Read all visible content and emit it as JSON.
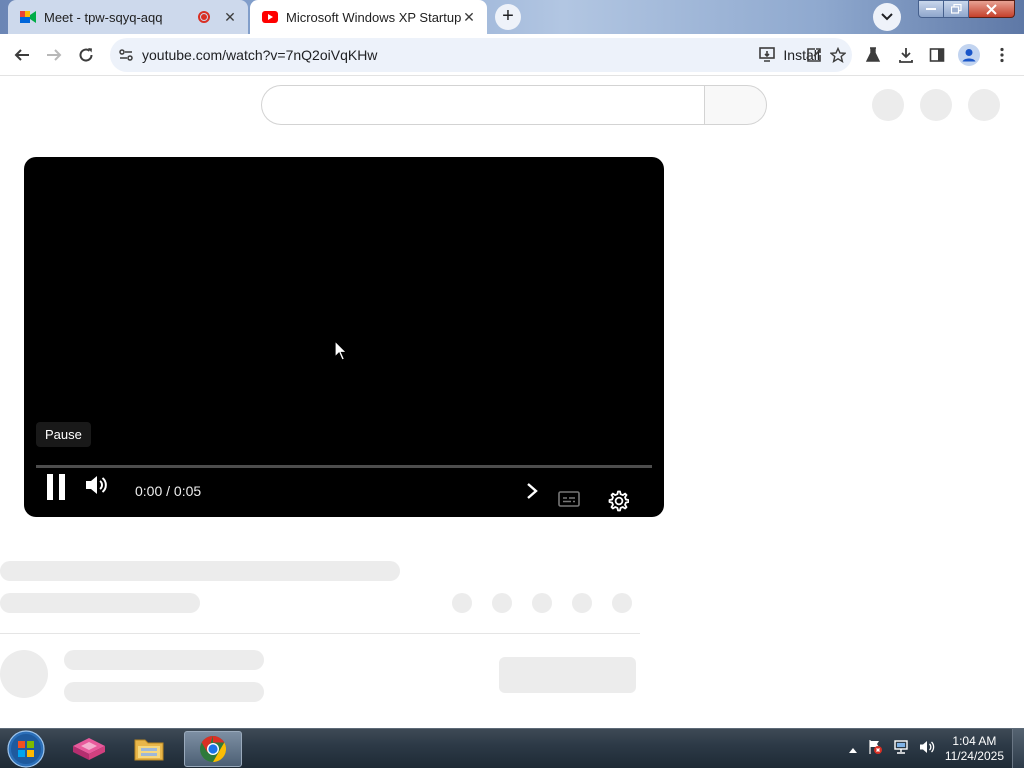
{
  "browser": {
    "tabs": [
      {
        "title": "Meet - tpw-sqyq-aqq",
        "icon": "google-meet-icon",
        "recording": true
      },
      {
        "title": "Microsoft Windows XP Startup S",
        "icon": "youtube-icon",
        "active": true
      }
    ],
    "close_glyph": "✕",
    "new_tab_glyph": "+",
    "address": "youtube.com/watch?v=7nQ2oiVqKHw",
    "install_label": "Install"
  },
  "player": {
    "tooltip": "Pause",
    "time": "0:00 / 0:05",
    "progress": 0.0
  },
  "taskbar": {
    "clock_time": "1:04 AM",
    "clock_date": "11/24/2025",
    "apps": [
      "start-orb",
      "app-cube-icon",
      "file-explorer-icon",
      "chrome-icon"
    ]
  },
  "colors": {
    "yt_red": "#ff0000",
    "player_bg": "#000000",
    "skeleton": "#ececec",
    "omnibox_bg": "#edf2fa"
  }
}
